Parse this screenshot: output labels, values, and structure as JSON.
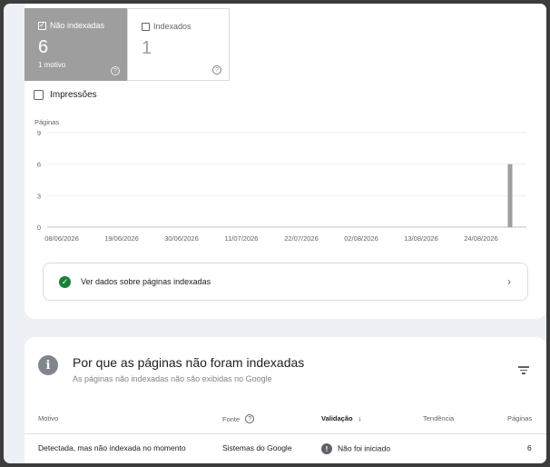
{
  "tiles": {
    "not_indexed": {
      "label": "Não indexadas",
      "count": "6",
      "sub": "1 motivo",
      "checked": true
    },
    "indexed": {
      "label": "Indexados",
      "count": "1",
      "checked": false
    }
  },
  "impressions_label": "Impressões",
  "chart_data": {
    "type": "bar",
    "ylabel": "Páginas",
    "yticks": [
      "9",
      "6",
      "3",
      "0"
    ],
    "ylim": [
      0,
      9
    ],
    "xtick_labels": [
      "08/06/2026",
      "19/06/2026",
      "30/06/2026",
      "11/07/2026",
      "22/07/2026",
      "02/08/2026",
      "13/08/2026",
      "24/08/2026"
    ],
    "series": [
      {
        "values": [
          {
            "date": "2026-09-01",
            "value": 6
          }
        ]
      }
    ],
    "bar_color": "#9e9e9e"
  },
  "indexed_link": "Ver dados sobre páginas indexadas",
  "section": {
    "title": "Por que as páginas não foram indexadas",
    "subtitle": "As páginas não indexadas não são exibidas no Google"
  },
  "table": {
    "headers": {
      "reason": "Motivo",
      "source": "Fonte",
      "validation": "Validação",
      "trend": "Tendência",
      "pages": "Páginas"
    },
    "rows": [
      {
        "reason": "Detectada, mas não indexada no momento",
        "source": "Sistemas do Google",
        "validation": "Não foi iniciado",
        "pages": "6"
      }
    ]
  },
  "icons": {
    "check": "check-icon",
    "help": "help-icon",
    "info": "info-icon",
    "filter": "filter-icon",
    "chevron": "chevron-right-icon",
    "warning": "exclamation-icon"
  }
}
